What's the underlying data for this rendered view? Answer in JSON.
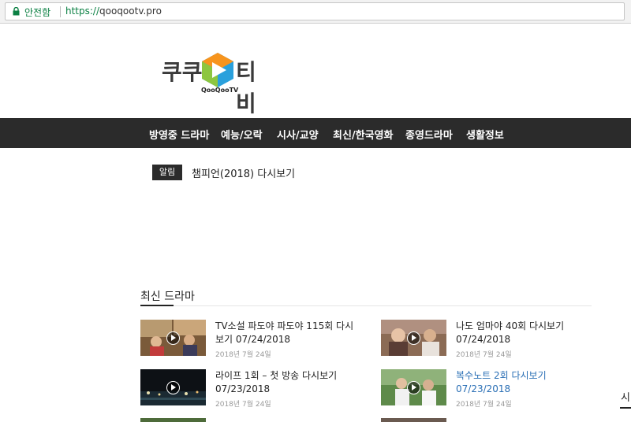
{
  "browser": {
    "secure_label": "안전함",
    "url_scheme": "https://",
    "url_host": "qooqootv.pro"
  },
  "logo": {
    "ko_left": "쿠쿠",
    "ko_right": "티비",
    "en": "QooQooTV"
  },
  "nav": {
    "items": [
      {
        "label": "방영중 드라마"
      },
      {
        "label": "예능/오락"
      },
      {
        "label": "시사/교양"
      },
      {
        "label": "최신/한국영화"
      },
      {
        "label": "종영드라마"
      },
      {
        "label": "생활정보"
      }
    ]
  },
  "notice": {
    "badge": "알림",
    "text": "챔피언(2018) 다시보기"
  },
  "section": {
    "title": "최신 드라마",
    "edge_char": "시"
  },
  "posts": [
    {
      "title": "TV소설 파도야 파도야 115회 다시보기 07/24/2018",
      "date": "2018년 7월 24일",
      "linked": false
    },
    {
      "title": "나도 엄마야 40회 다시보기 07/24/2018",
      "date": "2018년 7월 24일",
      "linked": false
    },
    {
      "title": "라이프 1회 – 첫 방송 다시보기 07/23/2018",
      "date": "2018년 7월 24일",
      "linked": false
    },
    {
      "title": "복수노트 2회 다시보기 07/23/2018",
      "date": "2018년 7월 24일",
      "linked": true
    }
  ],
  "colors": {
    "nav_bg": "#2b2b2b",
    "link_blue": "#2a6fb5",
    "secure_green": "#0b8043",
    "logo_blue": "#2aa0dc",
    "logo_orange": "#f7941d",
    "logo_green": "#8dc63f"
  }
}
